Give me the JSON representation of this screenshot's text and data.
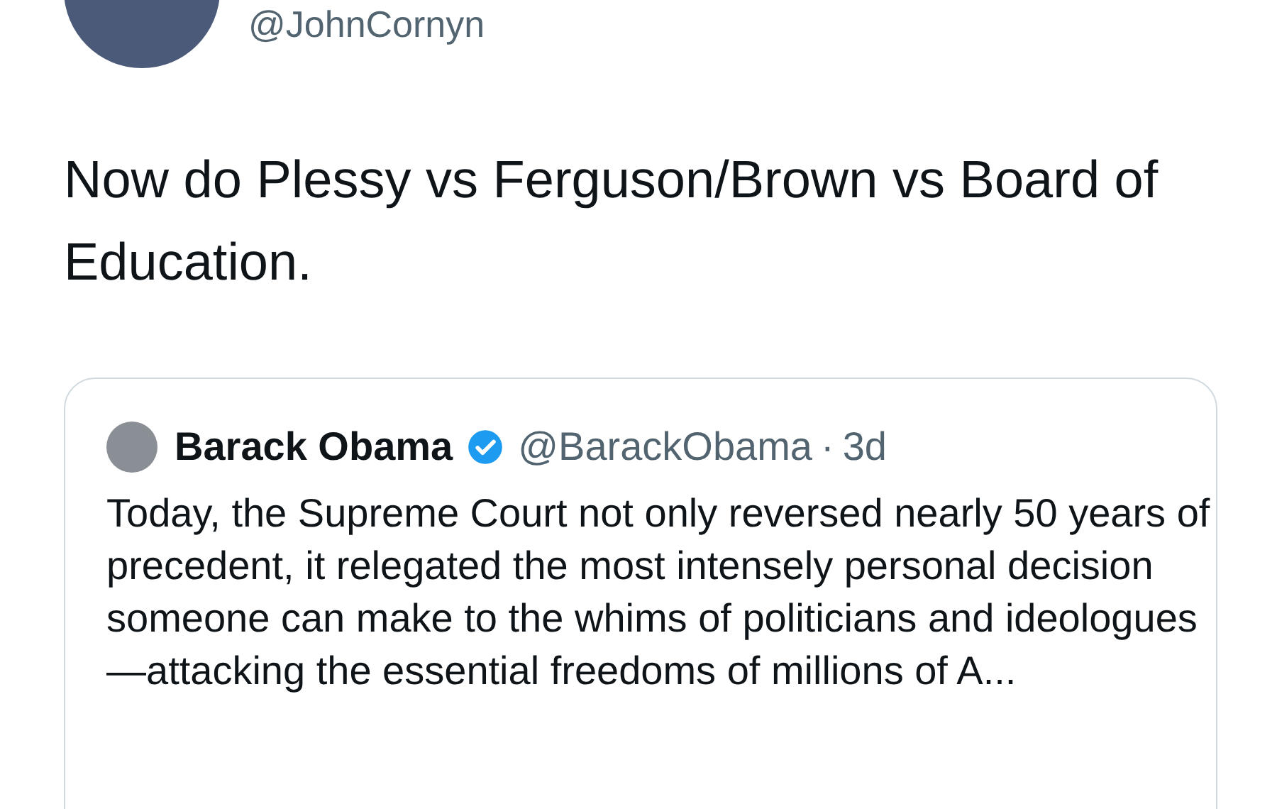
{
  "tweet": {
    "handle": "@JohnCornyn",
    "text": "Now do Plessy vs Ferguson/Brown vs Board of Education."
  },
  "quoted_tweet": {
    "name": "Barack Obama",
    "verified": true,
    "handle": "@BarackObama",
    "separator": "·",
    "time": "3d",
    "text": "Today, the Supreme Court not only reversed nearly 50 years of precedent, it relegated the most intensely personal decision someone can make to the whims of politicians and ideologues—attacking the essential freedoms of millions of A..."
  }
}
